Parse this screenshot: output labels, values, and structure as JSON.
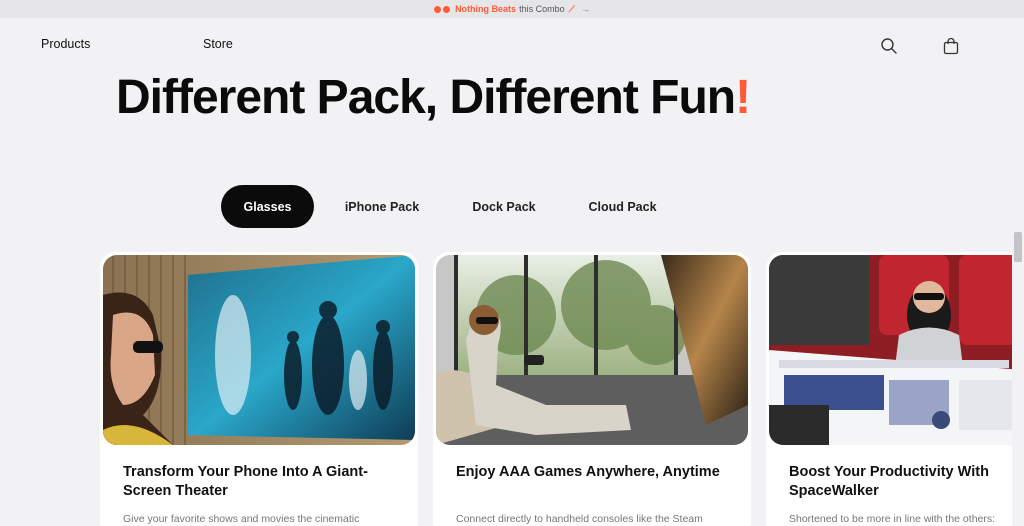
{
  "promo": {
    "accent_text": "Nothing Beats",
    "rest_text": "this Combo",
    "sparkle_icon": "sparkle-icon",
    "arrow_icon": "arrow-right-icon"
  },
  "nav": {
    "products_label": "Products",
    "store_label": "Store",
    "search_icon": "search-icon",
    "bag_icon": "shopping-bag-icon"
  },
  "hero": {
    "title": "Different Pack, Different Fun",
    "exclamation": "!"
  },
  "tabs": [
    {
      "label": "Glasses",
      "active": true
    },
    {
      "label": "iPhone Pack",
      "active": false
    },
    {
      "label": "Dock Pack",
      "active": false
    },
    {
      "label": "Cloud Pack",
      "active": false
    }
  ],
  "cards": [
    {
      "title": "Transform Your Phone Into A Giant-Screen Theater",
      "desc": "Give your favorite shows and movies the cinematic"
    },
    {
      "title": "Enjoy AAA Games Anywhere, Anytime",
      "desc": "Connect directly to handheld consoles like the Steam"
    },
    {
      "title": "Boost Your Productivity With SpaceWalker",
      "desc": "Shortened to be more in line with the others:"
    }
  ],
  "colors": {
    "accent": "#ff5a36",
    "active_tab": "#0b0b0b",
    "background": "#f2f2f4"
  }
}
